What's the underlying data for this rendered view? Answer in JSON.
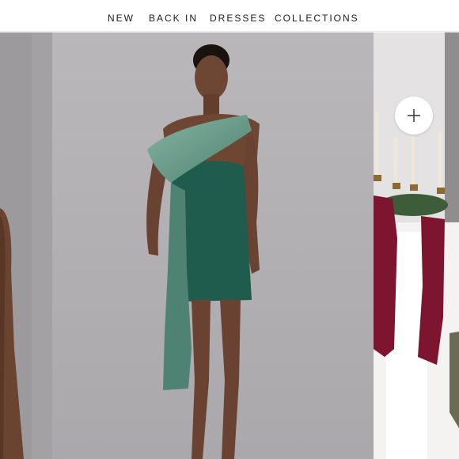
{
  "nav": {
    "items": [
      {
        "label": "NEW"
      },
      {
        "label": "BACK IN"
      },
      {
        "label": "DRESSES"
      },
      {
        "label": "COLLECTIONS"
      }
    ]
  },
  "carousel": {
    "plus_icon": "plus-icon",
    "slides": [
      {
        "image": "model-partial-left-photo"
      },
      {
        "image": "model-green-drape-dress-photo",
        "dress_color": "#1f5c4d",
        "drape_color": "#6f9f8d"
      },
      {
        "image": "holiday-mantel-candles-burgundy-bows-photo",
        "bow_color": "#7d1530"
      }
    ]
  }
}
